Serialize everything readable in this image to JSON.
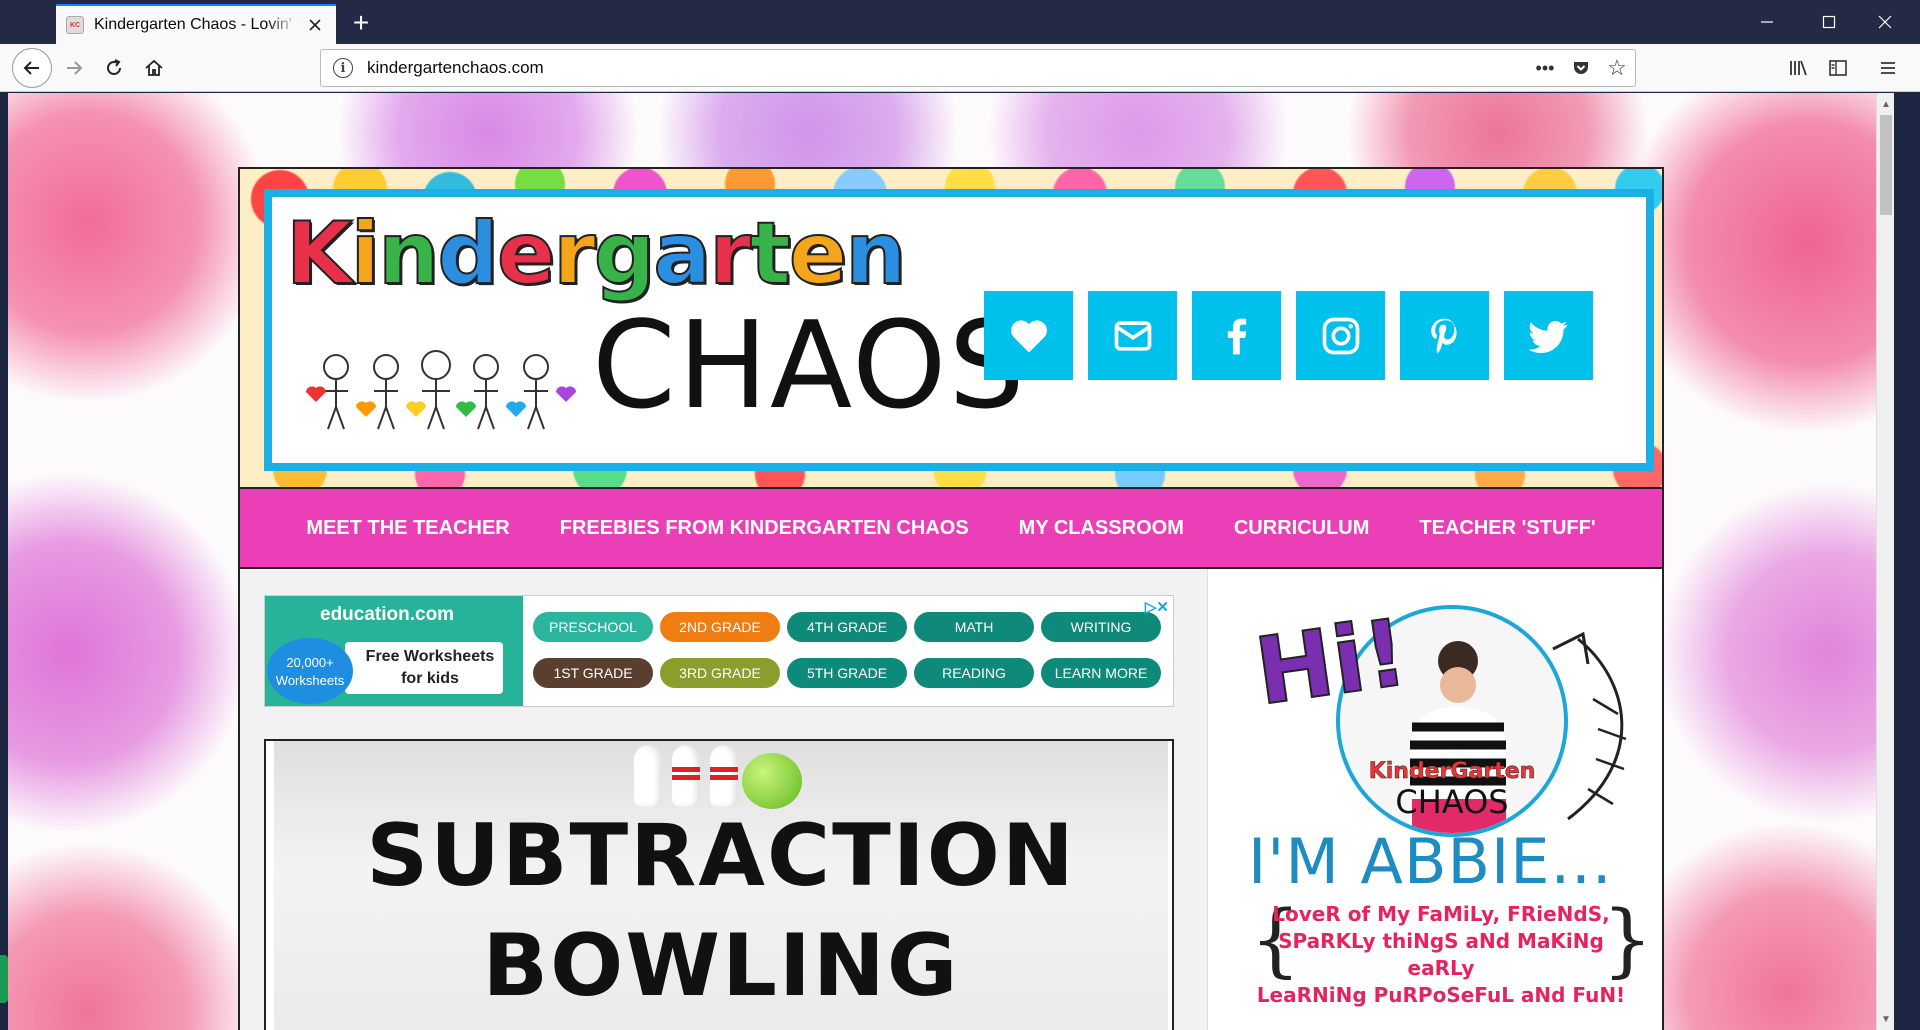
{
  "browser": {
    "tab_title": "Kindergarten Chaos - Lovin' the Little Years",
    "tab_favicon_text": "KC",
    "new_tab_symbol": "+",
    "url": "kindergartenchaos.com",
    "url_info_symbol": "i",
    "window_controls": {
      "minimize": "—",
      "maximize": "☐",
      "close": "✕"
    },
    "page_actions": {
      "more": "•••",
      "star": "☆"
    }
  },
  "site": {
    "logo_top_letters": [
      "K",
      "i",
      "n",
      "d",
      "e",
      "r",
      "g",
      "a",
      "r",
      "t",
      "e",
      "n"
    ],
    "logo_top_colors": [
      "#e8304a",
      "#f4a51c",
      "#37b34a",
      "#2b8ee0",
      "#e8304a",
      "#f4a51c",
      "#37b34a",
      "#2b8ee0",
      "#e8304a",
      "#37b34a",
      "#f4a51c",
      "#2b8ee0"
    ],
    "logo_bottom": "CHAOS",
    "social_icons": [
      "heart-icon",
      "email-icon",
      "facebook-icon",
      "instagram-icon",
      "pinterest-icon",
      "twitter-icon"
    ],
    "accent_color": "#ea3fb7",
    "social_color": "#00c1ec",
    "menu": [
      "MEET THE TEACHER",
      "FREEBIES FROM KINDERGARTEN CHAOS",
      "MY CLASSROOM",
      "CURRICULUM",
      "TEACHER 'STUFF'"
    ]
  },
  "ad": {
    "brand": "education.com",
    "badge_line1": "20,000+",
    "badge_line2": "Worksheets",
    "cloud_line1": "Free Worksheets",
    "cloud_line2": "for kids",
    "choices_symbol": "▷✕",
    "pills": [
      {
        "label": "PRESCHOOL",
        "color": "#2bb59c"
      },
      {
        "label": "2ND GRADE",
        "color": "#f07d12"
      },
      {
        "label": "4TH GRADE",
        "color": "#0f8a7a"
      },
      {
        "label": "MATH",
        "color": "#0f8a7a"
      },
      {
        "label": "WRITING",
        "color": "#0f8a7a"
      },
      {
        "label": "1ST GRADE",
        "color": "#5a3f2f"
      },
      {
        "label": "3RD GRADE",
        "color": "#8b9d2c"
      },
      {
        "label": "5TH GRADE",
        "color": "#0f8a7a"
      },
      {
        "label": "READING",
        "color": "#0f8a7a"
      },
      {
        "label": "LEARN MORE",
        "color": "#0f8a7a"
      }
    ]
  },
  "post": {
    "title_line1": "SUBTRACTION",
    "title_line2": "BOWLING"
  },
  "sidebar": {
    "hi": "Hi!",
    "portrait_logo_top": "KinderGarten",
    "portrait_logo_bottom": "CHAOS",
    "im_abbie": "I'M ABBIE...",
    "tagline_1": "LoveR of My FaMiLy, FRieNdS,",
    "tagline_2": "SPaRKLy thiNgS aNd MaKiNg eaRLy",
    "tagline_3": "LeaRNiNg PuRPoSeFuL aNd FuN!",
    "brace_left": "{",
    "brace_right": "}"
  }
}
